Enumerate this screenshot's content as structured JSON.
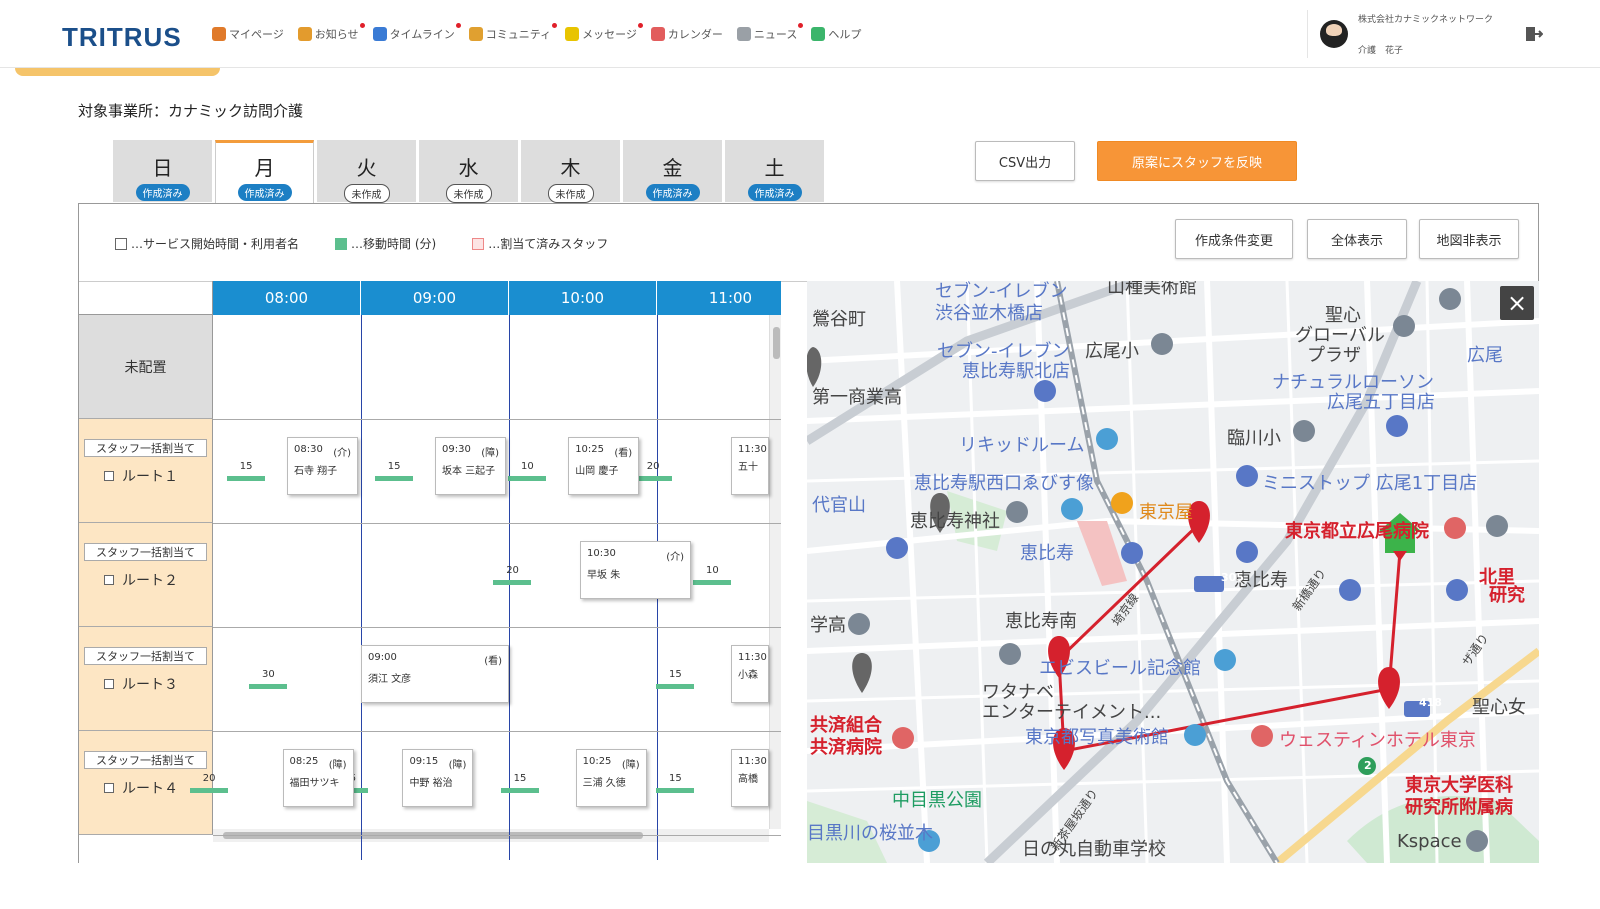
{
  "header": {
    "logo_main": "TRITRUS",
    "nav": [
      {
        "label": "マイページ",
        "color": "#e07a2a",
        "dot": false
      },
      {
        "label": "お知らせ",
        "color": "#e39b2d",
        "dot": true
      },
      {
        "label": "タイムライン",
        "color": "#3a7bd5",
        "dot": true
      },
      {
        "label": "コミュニティ",
        "color": "#e0a030",
        "dot": true
      },
      {
        "label": "メッセージ",
        "color": "#e8c400",
        "dot": true
      },
      {
        "label": "カレンダー",
        "color": "#e25d5d",
        "dot": false
      },
      {
        "label": "ニュース",
        "color": "#9aa0a6",
        "dot": true
      },
      {
        "label": "ヘルプ",
        "color": "#3bb56b",
        "dot": false
      }
    ],
    "user_company": "株式会社カナミックネットワーク",
    "user_name": "介護　花子"
  },
  "office_label": "対象事業所：カナミック訪問介護",
  "tabs": [
    {
      "day": "日",
      "status": "作成済み",
      "done": true,
      "active": false
    },
    {
      "day": "月",
      "status": "作成済み",
      "done": true,
      "active": true
    },
    {
      "day": "火",
      "status": "未作成",
      "done": false,
      "active": false
    },
    {
      "day": "水",
      "status": "未作成",
      "done": false,
      "active": false
    },
    {
      "day": "木",
      "status": "未作成",
      "done": false,
      "active": false
    },
    {
      "day": "金",
      "status": "作成済み",
      "done": true,
      "active": false
    },
    {
      "day": "土",
      "status": "作成済み",
      "done": true,
      "active": false
    }
  ],
  "buttons": {
    "csv": "CSV出力",
    "reflect": "原案にスタッフを反映",
    "change_conditions": "作成条件変更",
    "show_all": "全体表示",
    "hide_map": "地図非表示"
  },
  "legend": {
    "service": "…サービス開始時間・利用者名",
    "move": "…移動時間 (分)",
    "assigned": "…割当て済みスタッフ"
  },
  "schedule": {
    "times": [
      "08:00",
      "09:00",
      "10:00",
      "11:00"
    ],
    "unassigned_label": "未配置",
    "bulk_label": "スタッフ一括割当て",
    "routes": [
      {
        "label": "ルート１",
        "moves": [
          {
            "mins": "15",
            "slot": 0.35
          },
          {
            "mins": "15",
            "slot": 1.35
          },
          {
            "mins": "10",
            "slot": 2.25
          },
          {
            "mins": "20",
            "slot": 3.1
          }
        ],
        "cards": [
          {
            "time": "08:30",
            "type": "(介)",
            "name": "石寺 翔子",
            "slot": 0.5,
            "w": 0.48
          },
          {
            "time": "09:30",
            "type": "(障)",
            "name": "坂本 三起子",
            "slot": 1.5,
            "w": 0.48
          },
          {
            "time": "10:25",
            "type": "(看)",
            "name": "山岡 慶子",
            "slot": 2.4,
            "w": 0.48
          },
          {
            "time": "11:30",
            "type": "",
            "name": "五十",
            "slot": 3.5,
            "w": 0.3
          }
        ]
      },
      {
        "label": "ルート２",
        "moves": [
          {
            "mins": "20",
            "slot": 2.15
          },
          {
            "mins": "10",
            "slot": 3.5
          }
        ],
        "cards": [
          {
            "time": "10:30",
            "type": "(介)",
            "name": "早坂 朱",
            "slot": 2.48,
            "w": 0.75
          }
        ]
      },
      {
        "label": "ルート３",
        "moves": [
          {
            "mins": "30",
            "slot": 0.5
          },
          {
            "mins": "15",
            "slot": 3.25
          }
        ],
        "cards": [
          {
            "time": "09:00",
            "type": "(看)",
            "name": "須江 文彦",
            "slot": 1.0,
            "w": 1.0
          },
          {
            "time": "11:30",
            "type": "",
            "name": "小森",
            "slot": 3.5,
            "w": 0.3
          }
        ]
      },
      {
        "label": "ルート４",
        "moves": [
          {
            "mins": "20",
            "slot": 0.1
          },
          {
            "mins": "15",
            "slot": 1.05
          },
          {
            "mins": "15",
            "slot": 2.2
          },
          {
            "mins": "15",
            "slot": 3.25
          }
        ],
        "cards": [
          {
            "time": "08:25",
            "type": "(障)",
            "name": "福田サツキ",
            "slot": 0.47,
            "w": 0.48
          },
          {
            "time": "09:15",
            "type": "(障)",
            "name": "中野 裕治",
            "slot": 1.28,
            "w": 0.48
          },
          {
            "time": "10:25",
            "type": "(障)",
            "name": "三浦 久徳",
            "slot": 2.45,
            "w": 0.48
          },
          {
            "time": "11:30",
            "type": "",
            "name": "高橋",
            "slot": 3.5,
            "w": 0.3
          }
        ]
      }
    ]
  },
  "map": {
    "labels": [
      {
        "text": "山種美術館",
        "cls": "dark"
      },
      {
        "text": "鶯谷町",
        "cls": "dark"
      },
      {
        "text": "セブン-イレブン",
        "cls": ""
      },
      {
        "text": "渋谷並木橋店",
        "cls": ""
      },
      {
        "text": "聖心",
        "cls": "dark"
      },
      {
        "text": "グローバル",
        "cls": "dark"
      },
      {
        "text": "プラザ",
        "cls": "dark"
      },
      {
        "text": "セブン-イレブン",
        "cls": ""
      },
      {
        "text": "恵比寿駅北店",
        "cls": ""
      },
      {
        "text": "広尾小",
        "cls": "dark"
      },
      {
        "text": "広尾",
        "cls": ""
      },
      {
        "text": "第一商業高",
        "cls": "dark"
      },
      {
        "text": "ナチュラルローソン",
        "cls": ""
      },
      {
        "text": "広尾五丁目店",
        "cls": ""
      },
      {
        "text": "リキッドルーム",
        "cls": ""
      },
      {
        "text": "臨川小",
        "cls": "dark"
      },
      {
        "text": "恵比寿駅西口ゑびす像",
        "cls": ""
      },
      {
        "text": "ミニストップ 広尾1丁目店",
        "cls": ""
      },
      {
        "text": "代官山",
        "cls": ""
      },
      {
        "text": "恵比寿神社",
        "cls": "dark"
      },
      {
        "text": "東京屋",
        "cls": "orange"
      },
      {
        "text": "東京都立広尾病院",
        "cls": "red"
      },
      {
        "text": "恵比寿",
        "cls": ""
      },
      {
        "text": "恵比寿",
        "cls": "dark"
      },
      {
        "text": "北里",
        "cls": "red"
      },
      {
        "text": "研究",
        "cls": "red"
      },
      {
        "text": "恵比寿南",
        "cls": "dark"
      },
      {
        "text": "学高",
        "cls": "dark"
      },
      {
        "text": "エビスビール記念館",
        "cls": ""
      },
      {
        "text": "ワタナベ",
        "cls": "dark"
      },
      {
        "text": "エンターテイメント...",
        "cls": "dark"
      },
      {
        "text": "聖心女",
        "cls": "dark"
      },
      {
        "text": "共済組合",
        "cls": "red"
      },
      {
        "text": "共済病院",
        "cls": "red"
      },
      {
        "text": "東京都写真美術館",
        "cls": ""
      },
      {
        "text": "ウェスティンホテル東京",
        "cls": "pink"
      },
      {
        "text": "東京大学医科",
        "cls": "red"
      },
      {
        "text": "研究所附属病",
        "cls": "red"
      },
      {
        "text": "中目黒公園",
        "cls": "green"
      },
      {
        "text": "目黒川の桜並木",
        "cls": ""
      },
      {
        "text": "Kspace",
        "cls": "dark"
      },
      {
        "text": "新茶屋坂通り",
        "cls": "dark"
      },
      {
        "text": "埼京線",
        "cls": "dark"
      },
      {
        "text": "新橋通り",
        "cls": "dark"
      },
      {
        "text": "ザ通り",
        "cls": "dark"
      },
      {
        "text": "305",
        "cls": "shield"
      },
      {
        "text": "418",
        "cls": "shield"
      },
      {
        "text": "2",
        "cls": "shield2"
      },
      {
        "text": "日の丸自動車学校",
        "cls": "dark"
      }
    ],
    "close_label": "×"
  }
}
